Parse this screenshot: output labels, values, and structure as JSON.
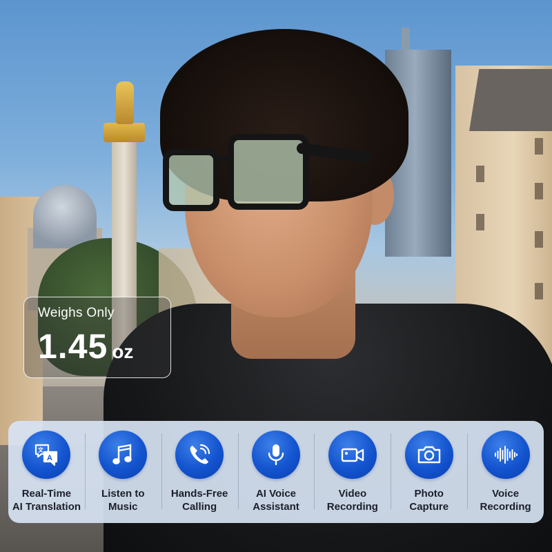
{
  "weight": {
    "label": "Weighs Only",
    "value": "1.45",
    "unit": "oz"
  },
  "features": [
    {
      "line1": "Real-Time",
      "line2": "AI Translation",
      "icon": "translate-icon"
    },
    {
      "line1": "Listen to",
      "line2": "Music",
      "icon": "music-note-icon"
    },
    {
      "line1": "Hands-Free",
      "line2": "Calling",
      "icon": "phone-icon"
    },
    {
      "line1": "AI Voice",
      "line2": "Assistant",
      "icon": "microphone-icon"
    },
    {
      "line1": "Video",
      "line2": "Recording",
      "icon": "video-camera-icon"
    },
    {
      "line1": "Photo",
      "line2": "Capture",
      "icon": "camera-icon"
    },
    {
      "line1": "Voice",
      "line2": "Recording",
      "icon": "sound-wave-icon"
    }
  ],
  "colors": {
    "icon_blue": "#1354cf",
    "panel": "#d6e2f2",
    "label_text": "#1b1f2a"
  }
}
